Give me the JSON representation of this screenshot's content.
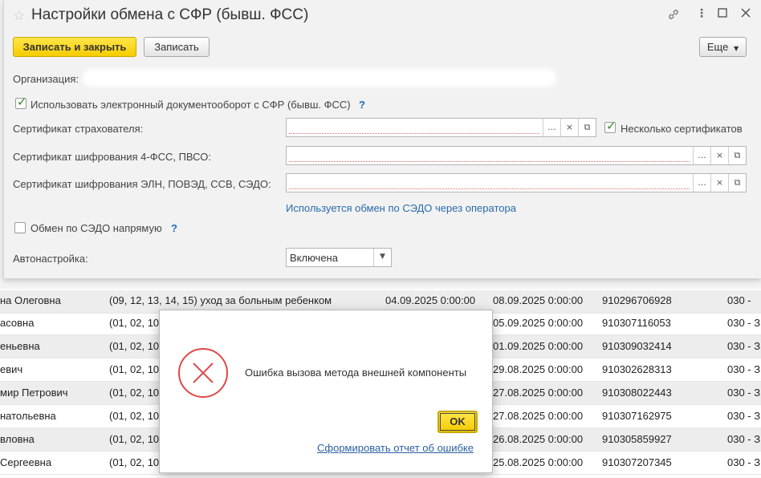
{
  "background_table": {
    "rows": [
      {
        "name": "на Олеговна",
        "codes": "(09, 12, 13, 14, 15) уход за больным ребенком",
        "date1": "04.09.2025 0:00:00",
        "date2": "08.09.2025 0:00:00",
        "number": "910296706928",
        "code": "030 -"
      },
      {
        "name": "асовна",
        "codes": "(01, 02, 10",
        "date1": "",
        "date2": "05.09.2025 0:00:00",
        "number": "910307116053",
        "code": "030 - З"
      },
      {
        "name": "еньевна",
        "codes": "(01, 02, 10",
        "date1": "",
        "date2": "01.09.2025 0:00:00",
        "number": "910309032414",
        "code": "030 - З"
      },
      {
        "name": "евич",
        "codes": "(01, 02, 10",
        "date1": "",
        "date2": "29.08.2025 0:00:00",
        "number": "910302628313",
        "code": "030 - З"
      },
      {
        "name": "мир Петрович",
        "codes": "(01, 02, 10",
        "date1": "",
        "date2": "27.08.2025 0:00:00",
        "number": "910308022443",
        "code": "030 - З"
      },
      {
        "name": "натольевна",
        "codes": "(01, 02, 10",
        "date1": "",
        "date2": "27.08.2025 0:00:00",
        "number": "910307162975",
        "code": "030 - З"
      },
      {
        "name": "вловна",
        "codes": "(01, 02, 10",
        "date1": "",
        "date2": "26.08.2025 0:00:00",
        "number": "910305859927",
        "code": "030 - З"
      },
      {
        "name": "Сергеевна",
        "codes": "(01, 02, 10",
        "date1": "",
        "date2": "25.08.2025 0:00:00",
        "number": "910307207345",
        "code": "030 - З"
      }
    ]
  },
  "form": {
    "title": "Настройки обмена с СФР (бывш. ФСС)",
    "toolbar": {
      "save_close": "Записать и закрыть",
      "save": "Записать",
      "more": "Еще"
    },
    "organization_label": "Организация:",
    "use_edo_label": "Использовать электронный документооборот с СФР (бывш. ФСС)",
    "help_mark": "?",
    "insurer_cert_label": "Сертификат страхователя:",
    "multiple_certs_label": "Несколько сертификатов",
    "cert_4fss_label": "Сертификат шифрования 4-ФСС, ПВСО:",
    "cert_eln_label": "Сертификат шифрования ЭЛН, ПОВЭД, ССВ, СЭДО:",
    "sedo_operator_link": "Используется обмен по СЭДО через оператора",
    "sedo_direct_label": "Обмен по СЭДО напрямую",
    "autosetup_label": "Автонастройка:",
    "autosetup_value": "Включена",
    "field_buttons": {
      "choose": "...",
      "clear": "×",
      "open": "⧉"
    }
  },
  "dialog": {
    "message": "Ошибка вызова метода внешней компоненты",
    "ok": "OK",
    "report_link": "Сформировать отчет об ошибке"
  }
}
